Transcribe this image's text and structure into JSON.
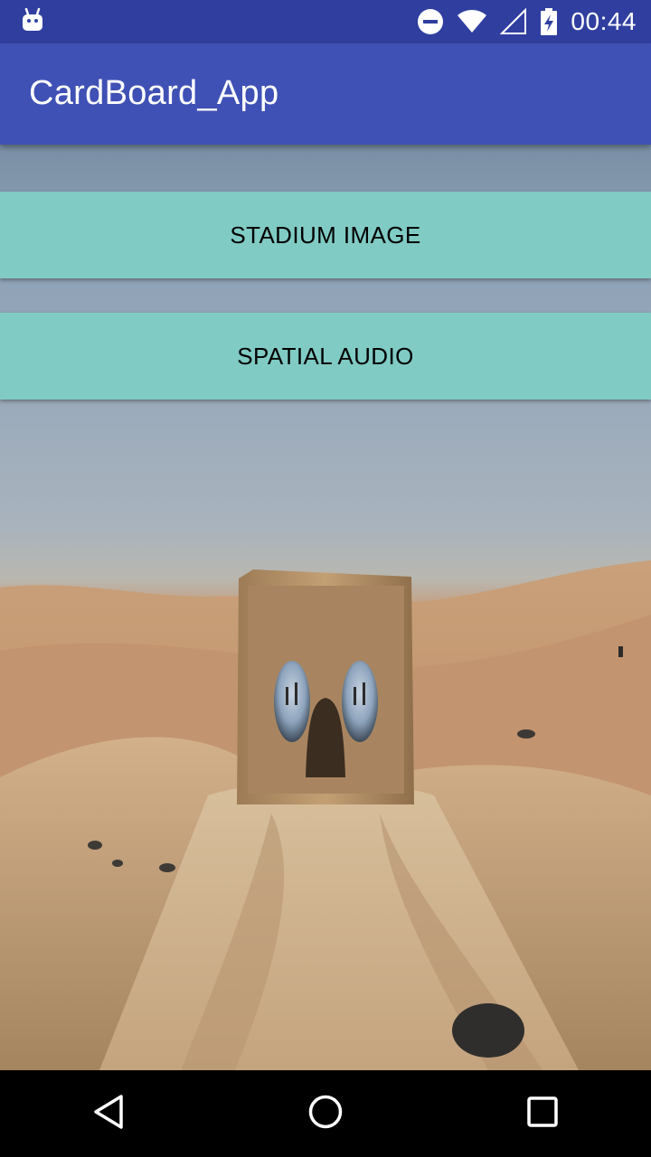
{
  "status_bar": {
    "time": "00:44",
    "icons": [
      "android-debug-icon",
      "do-not-disturb-icon",
      "wifi-icon",
      "signal-icon",
      "battery-charging-icon"
    ]
  },
  "app_bar": {
    "title": "CardBoard_App"
  },
  "buttons": {
    "stadium_image": "STADIUM IMAGE",
    "spatial_audio": "SPATIAL AUDIO"
  },
  "background": {
    "description_icon": "cardboard-viewer-desert-image"
  },
  "nav_bar": {
    "icons": [
      "back-icon",
      "home-icon",
      "recents-icon"
    ]
  },
  "colors": {
    "status_bar": "#303f9f",
    "app_bar": "#3f51b5",
    "button": "#80cbc4",
    "nav_bar": "#000000"
  }
}
